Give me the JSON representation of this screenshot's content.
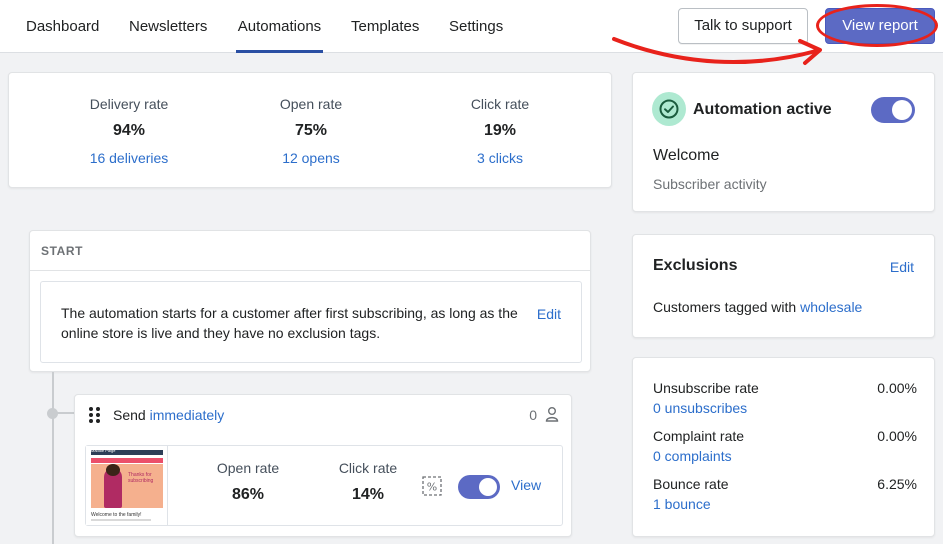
{
  "nav": {
    "tabs": [
      {
        "label": "Dashboard"
      },
      {
        "label": "Newsletters"
      },
      {
        "label": "Automations"
      },
      {
        "label": "Templates"
      },
      {
        "label": "Settings"
      }
    ],
    "active_tab": "Automations",
    "support_button": "Talk to support",
    "report_button": "View report"
  },
  "colors": {
    "accent": "#5c6ac4",
    "link": "#2c6ecb",
    "annotation": "#e8221b",
    "success": "#008060"
  },
  "summary": {
    "metrics": [
      {
        "label": "Delivery rate",
        "value": "94%",
        "sub": "16 deliveries"
      },
      {
        "label": "Open rate",
        "value": "75%",
        "sub": "12 opens"
      },
      {
        "label": "Click rate",
        "value": "19%",
        "sub": "3 clicks"
      }
    ]
  },
  "flow": {
    "start_label": "START",
    "start_text": "The automation starts for a customer after first subscribing, as long as the online store is live and they have no exclusion tags.",
    "start_edit": "Edit",
    "email": {
      "send_prefix": "Send",
      "send_timing": "immediately",
      "recipient_count": "0",
      "open_label": "Open rate",
      "open_value": "86%",
      "click_label": "Click rate",
      "click_value": "14%",
      "view_link": "View",
      "thumbnail": {
        "brand": "Maddie Paige",
        "banner": "Thanks for subscribing",
        "body_text": "Welcome to the family!"
      }
    }
  },
  "status": {
    "title": "Automation active",
    "toggle_on": true,
    "name": "Welcome",
    "trigger": "Subscriber activity"
  },
  "exclusions": {
    "title": "Exclusions",
    "edit": "Edit",
    "text_prefix": "Customers tagged with",
    "tag": "wholesale"
  },
  "rates": [
    {
      "label": "Unsubscribe rate",
      "value": "0.00%",
      "sub": "0 unsubscribes"
    },
    {
      "label": "Complaint rate",
      "value": "0.00%",
      "sub": "0 complaints"
    },
    {
      "label": "Bounce rate",
      "value": "6.25%",
      "sub": "1 bounce"
    }
  ]
}
